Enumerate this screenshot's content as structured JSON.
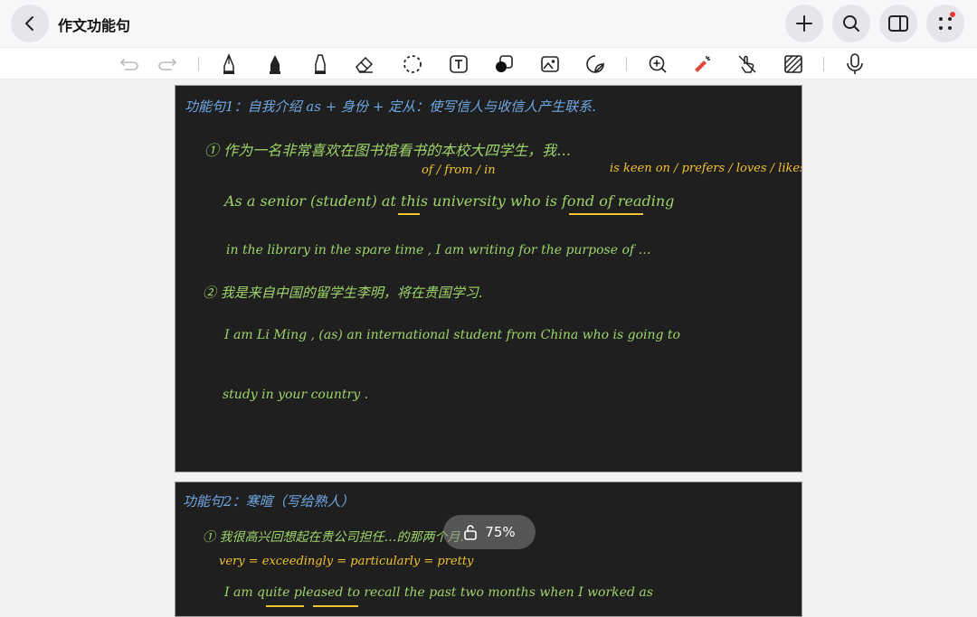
{
  "header": {
    "title": "作文功能句",
    "back_icon": "chevron-left-icon",
    "actions": [
      "plus-icon",
      "search-icon",
      "sidebar-icon",
      "more-dots-icon"
    ]
  },
  "toolbar": {
    "tools": [
      "undo-icon",
      "redo-icon",
      "fountain-pen-icon",
      "marker-icon",
      "highlighter-icon",
      "eraser-icon",
      "lasso-icon",
      "text-box-icon",
      "shape-icon",
      "image-icon",
      "sticker-icon",
      "zoom-icon",
      "laser-pointer-icon",
      "hand-touch-icon",
      "pattern-icon",
      "microphone-icon"
    ]
  },
  "zoom": {
    "level": "75%"
  },
  "page1": {
    "heading": "功能句1：自我介绍    as + 身份 + 定从：使写信人与收信人产生联系.",
    "item1_cn": "① 作为一名非常喜欢在图书馆看书的本校大四学生，我…",
    "item1_annot_of": "of / from / in",
    "item1_annot_keen": "is keen on / prefers / loves / likes",
    "item1_en_line1": "As a senior (student) at this university who is fond of reading",
    "item1_en_line2": "in the library in the spare time , I am writing for the purpose of …",
    "item2_cn": "② 我是来自中国的留学生李明，将在贵国学习.",
    "item2_en_line1": "I am Li Ming , (as) an international student from China who is going to",
    "item2_en_line2": "study in your country ."
  },
  "page2": {
    "heading": "功能句2：寒暄（写给熟人）",
    "item1_cn": "① 我很高兴回想起在贵公司担任…的那两个月.",
    "item1_annot": "very = exceedingly = particularly = pretty",
    "item1_en_line1": "I am quite pleased to recall the past two months when I worked as"
  },
  "colors": {
    "page_bg": "#1f1f1f",
    "heading_blue": "#6fa8e6",
    "ink_green": "#9ed46a",
    "ink_yellow": "#f2c230"
  }
}
